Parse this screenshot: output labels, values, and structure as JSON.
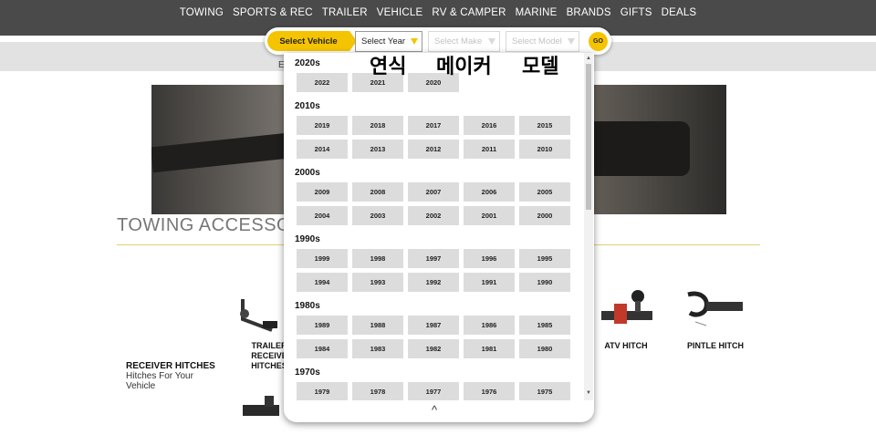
{
  "nav": [
    "TOWING",
    "SPORTS & REC",
    "TRAILER",
    "VEHICLE",
    "RV & CAMPER",
    "MARINE",
    "BRANDS",
    "GIFTS",
    "DEALS"
  ],
  "selector": {
    "label": "Select Vehicle",
    "year": "Select Year",
    "make": "Select Make",
    "model": "Select Model",
    "go": "GO"
  },
  "subbar_text": "E",
  "section_title": "TOWING ACCESSO",
  "products": {
    "receiver_title": "RECEIVER HITCHES",
    "receiver_sub": "Hitches For Your Vehicle",
    "trailer_line1": "TRAILER",
    "trailer_line2": "RECEIVE",
    "trailer_line3": "HITCHES",
    "atv": "ATV HITCH",
    "pintle": "PINTLE HITCH"
  },
  "annotations": [
    "연식",
    "메이커",
    "모델"
  ],
  "year_panel": {
    "decades": [
      {
        "label": "2020s",
        "years": [
          "2022",
          "2021",
          "2020"
        ]
      },
      {
        "label": "2010s",
        "years": [
          "2019",
          "2018",
          "2017",
          "2016",
          "2015",
          "2014",
          "2013",
          "2012",
          "2011",
          "2010"
        ]
      },
      {
        "label": "2000s",
        "years": [
          "2009",
          "2008",
          "2007",
          "2006",
          "2005",
          "2004",
          "2003",
          "2002",
          "2001",
          "2000"
        ]
      },
      {
        "label": "1990s",
        "years": [
          "1999",
          "1998",
          "1997",
          "1996",
          "1995",
          "1994",
          "1993",
          "1992",
          "1991",
          "1990"
        ]
      },
      {
        "label": "1980s",
        "years": [
          "1989",
          "1988",
          "1987",
          "1986",
          "1985",
          "1984",
          "1983",
          "1982",
          "1981",
          "1980"
        ]
      },
      {
        "label": "1970s",
        "years": [
          "1979",
          "1978",
          "1977",
          "1976",
          "1975"
        ]
      }
    ],
    "collapse": "^"
  },
  "colors": {
    "accent": "#f5c400",
    "nav_bg": "#4a4a4a"
  }
}
